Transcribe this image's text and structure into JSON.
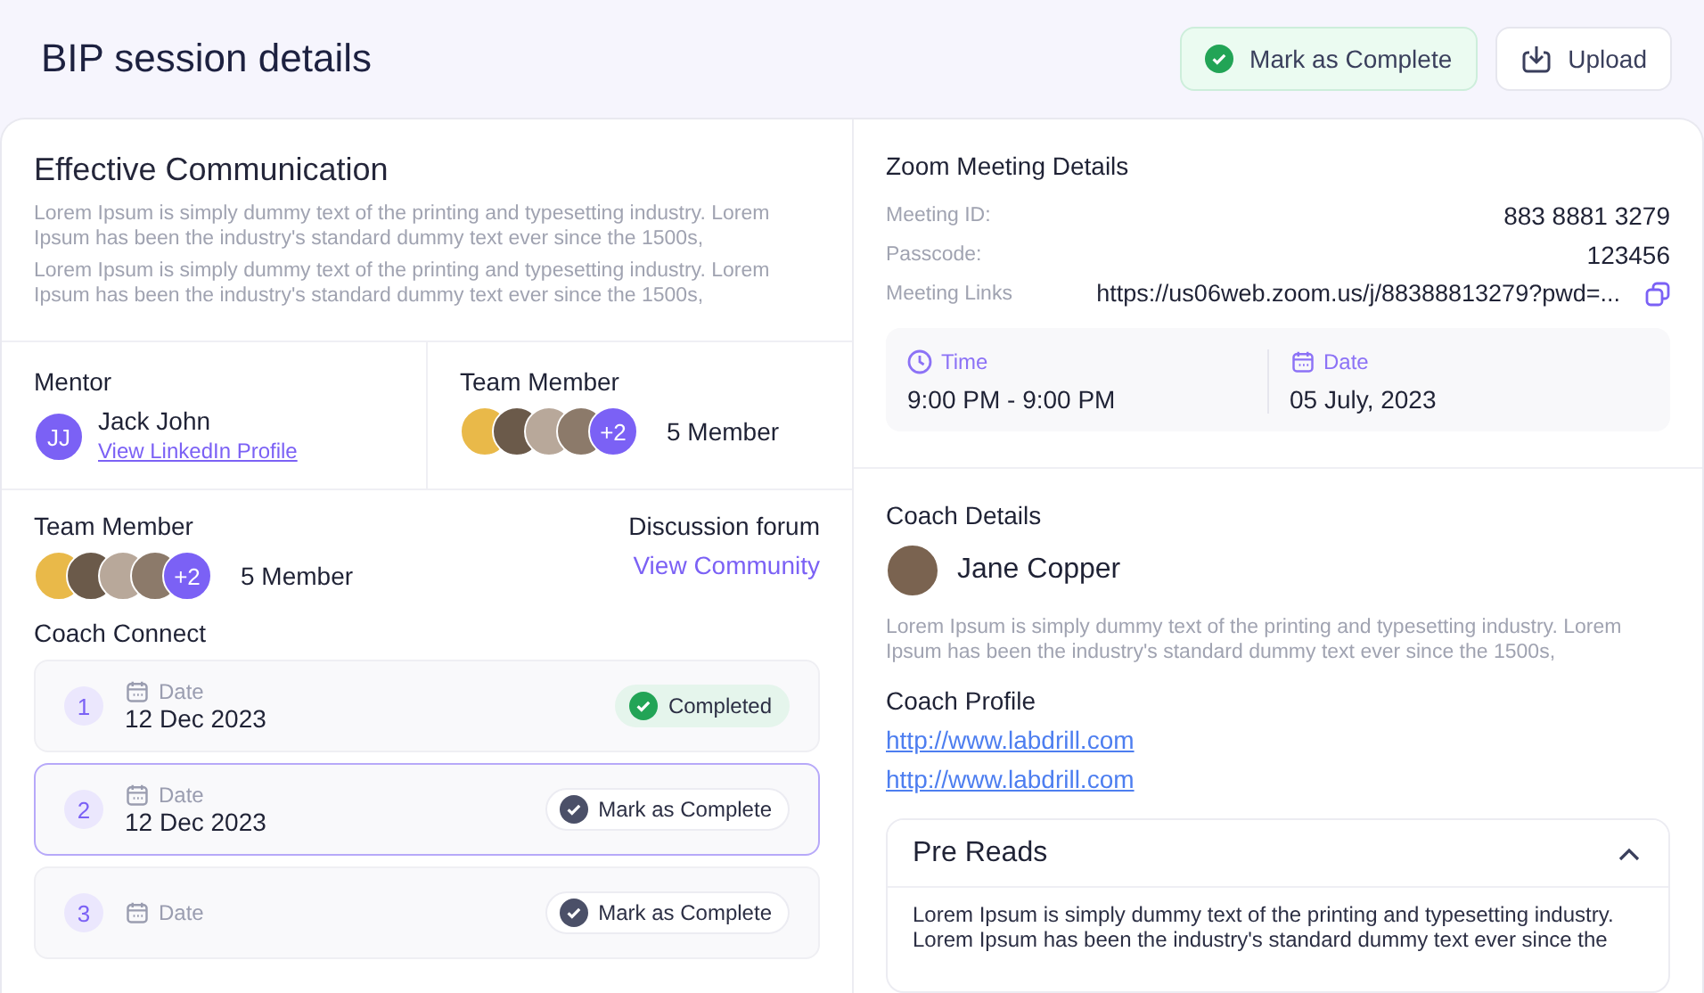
{
  "header": {
    "title": "BIP session details",
    "complete_button": {
      "label": "Mark as Complete",
      "checked": true
    },
    "upload_button": {
      "label": "Upload"
    }
  },
  "overview": {
    "title": "Effective Communication",
    "paragraphs": [
      "Lorem Ipsum is simply dummy text of the printing and typesetting industry. Lorem Ipsum has been the industry's standard dummy text ever since the 1500s,",
      "Lorem Ipsum is simply dummy text of the printing and typesetting industry. Lorem Ipsum has been the industry's standard dummy text ever since the 1500s,"
    ]
  },
  "mentor": {
    "label": "Mentor",
    "initials": "JJ",
    "name": "Jack John",
    "link": "View LinkedIn Profile"
  },
  "team_top": {
    "label": "Team Member",
    "more": "+2",
    "count": "5 Member",
    "avatars": [
      {
        "color": "#e9b949"
      },
      {
        "color": "#6b5a4a"
      },
      {
        "color": "#b8a89a"
      },
      {
        "color": "#8c7a6a"
      }
    ]
  },
  "team": {
    "label": "Team Member",
    "more": "+2",
    "count": "5 Member",
    "avatars": [
      {
        "color": "#e9b949"
      },
      {
        "color": "#6b5a4a"
      },
      {
        "color": "#b8a89a"
      },
      {
        "color": "#8c7a6a"
      }
    ]
  },
  "forum": {
    "label": "Discussion forum",
    "link": "View Community"
  },
  "coach_connect": {
    "title": "Coach Connect",
    "sessions": [
      {
        "number": "1",
        "date_label": "Date",
        "date": "12 Dec 2023",
        "kind": "completed",
        "status": "Completed",
        "selected": false
      },
      {
        "number": "2",
        "date_label": "Date",
        "date": "12 Dec 2023",
        "kind": "action",
        "status": "Mark as Complete",
        "selected": true
      },
      {
        "number": "3",
        "date_label": "Date",
        "kind": "action",
        "status": "Mark as Complete",
        "selected": false
      }
    ]
  },
  "zoom": {
    "title": "Zoom Meeting Details",
    "fields": [
      {
        "label": "Meeting ID:",
        "value": "883 8881 3279"
      },
      {
        "label": "Passcode:",
        "value": "123456"
      }
    ],
    "link_label": "Meeting Links",
    "link": "https://us06web.zoom.us/j/88388813279?pwd=...",
    "time_label": "Time",
    "time": "9:00 PM - 9:00 PM",
    "date_label": "Date",
    "date": "05 July, 2023"
  },
  "coach": {
    "title": "Coach Details",
    "name": "Jane Copper",
    "bio": "Lorem Ipsum is simply dummy text of the printing and typesetting industry. Lorem Ipsum has been the industry's standard dummy text ever since the 1500s,",
    "profile_title": "Coach Profile",
    "links": [
      "http://www.labdrill.com",
      "http://www.labdrill.com"
    ]
  },
  "pre_reads": {
    "title": "Pre Reads",
    "expanded": true,
    "text": "Lorem Ipsum is simply dummy text of the printing and typesetting industry. Lorem Ipsum has been the industry's standard dummy text ever since the"
  }
}
